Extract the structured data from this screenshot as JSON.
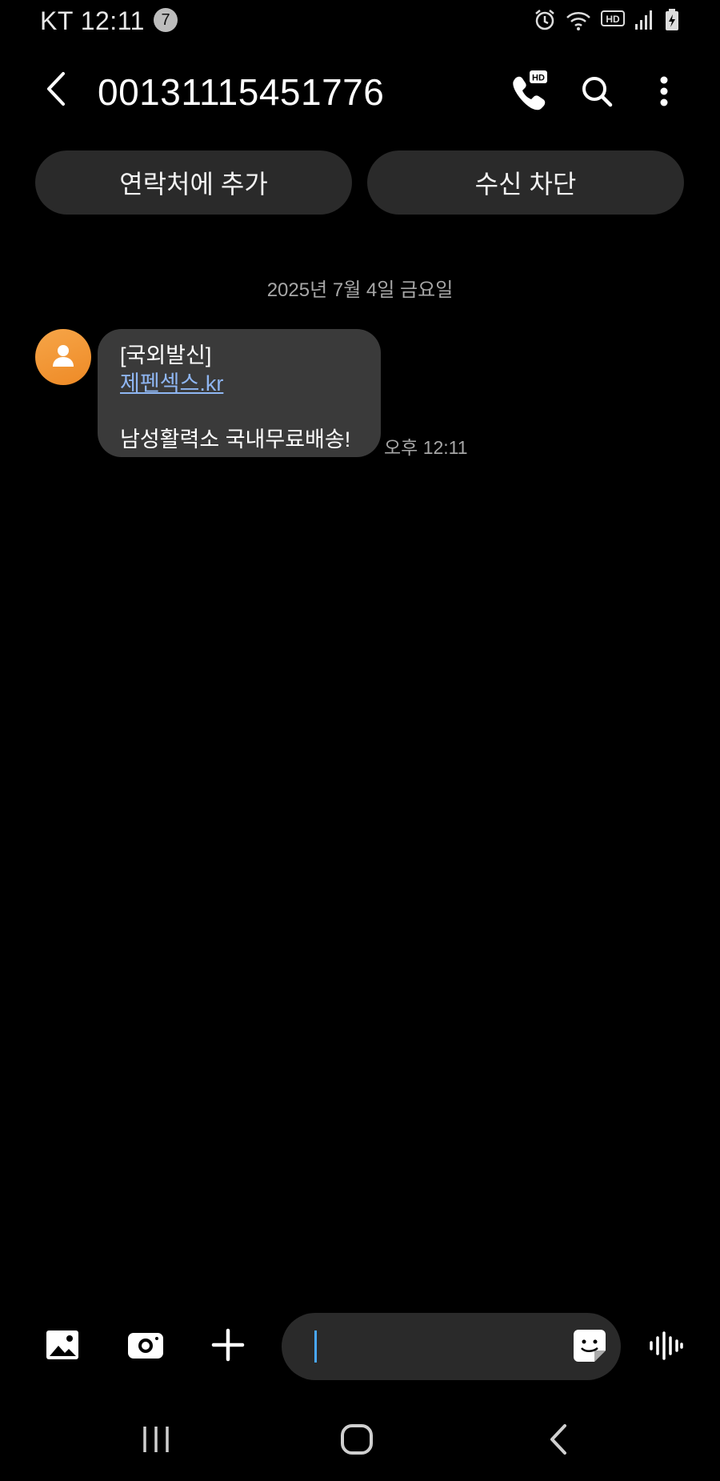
{
  "status_bar": {
    "carrier_time": "KT 12:11",
    "notification_count": "7",
    "icons": [
      "alarm-icon",
      "wifi-icon",
      "hd-voice-icon",
      "signal-icon",
      "battery-charging-icon"
    ]
  },
  "header": {
    "title": "00131115451776",
    "icons": [
      "back-arrow-icon",
      "hd-call-icon",
      "search-icon",
      "more-options-icon"
    ]
  },
  "actions": {
    "add_contact": "연락처에 추가",
    "block": "수신 차단"
  },
  "conversation": {
    "date": "2025년 7월 4일 금요일",
    "message": {
      "tag": "[국외발신]",
      "link": "제펜섹스.kr",
      "body": "남성활력소 국내무료배송!",
      "time": "오후 12:11"
    }
  },
  "composer": {
    "icons": [
      "gallery-icon",
      "camera-icon",
      "plus-icon",
      "sticker-icon",
      "voice-record-icon"
    ],
    "input_value": ""
  },
  "navigation": {
    "icons": [
      "recent-apps-icon",
      "home-icon",
      "back-icon"
    ]
  },
  "colors": {
    "background": "#000000",
    "pill": "#2a2a2a",
    "bubble": "#3a3a3a",
    "avatar": "#f29a3a",
    "link": "#8fb6f2",
    "caret": "#49a8ff"
  }
}
